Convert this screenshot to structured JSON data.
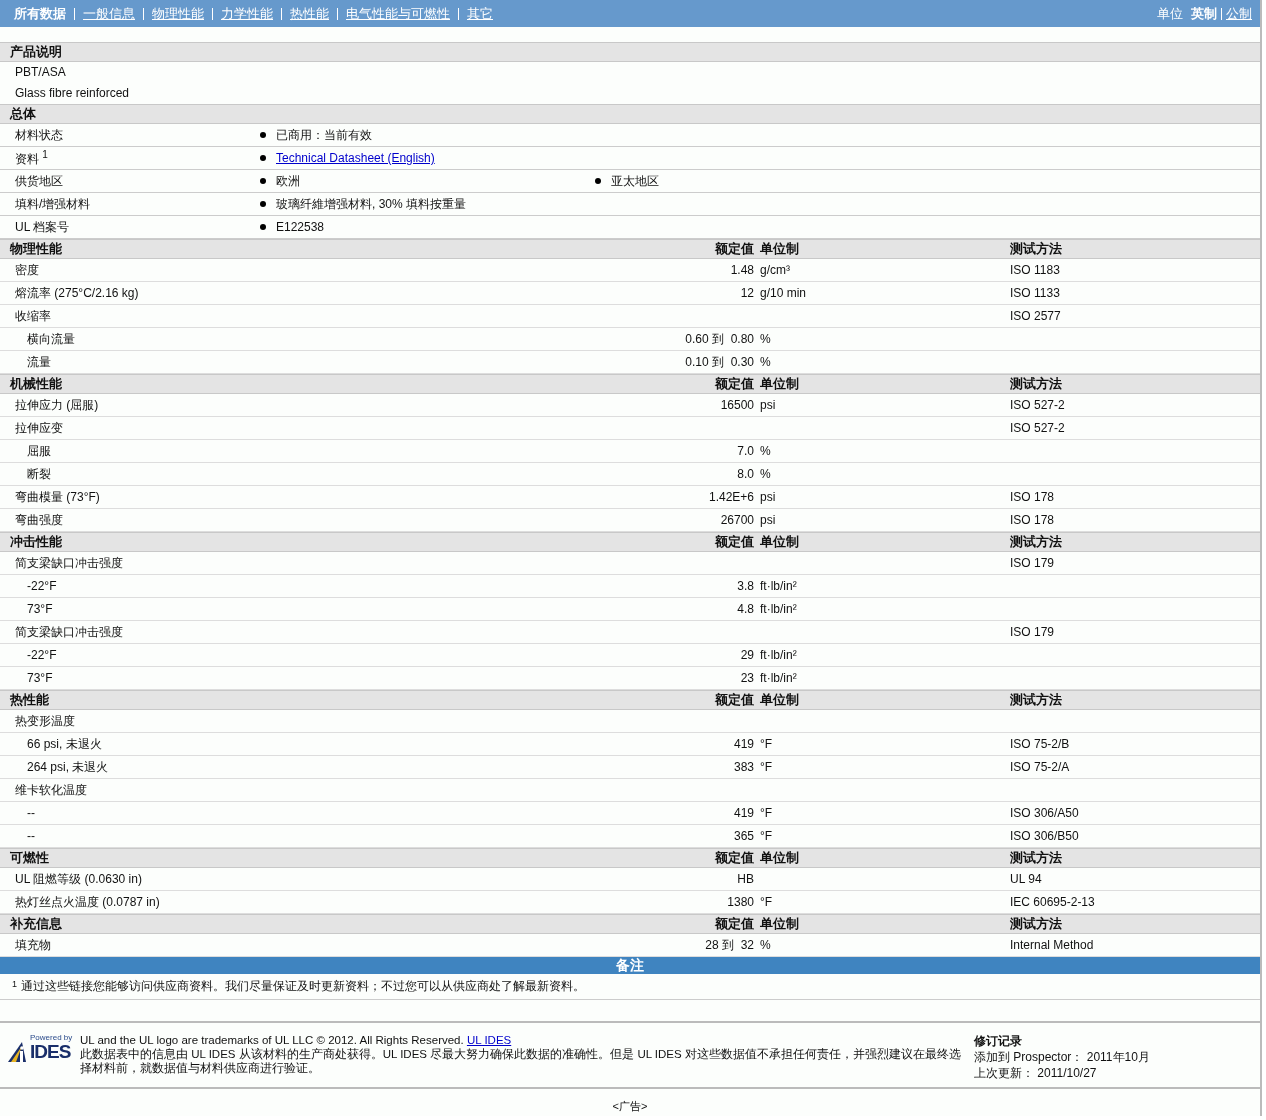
{
  "nav": {
    "tabs": [
      {
        "label": "所有数据",
        "selected": true
      },
      {
        "label": "一般信息",
        "selected": false
      },
      {
        "label": "物理性能",
        "selected": false
      },
      {
        "label": "力学性能",
        "selected": false
      },
      {
        "label": "热性能",
        "selected": false
      },
      {
        "label": "电气性能与可燃性",
        "selected": false
      },
      {
        "label": "其它",
        "selected": false
      }
    ],
    "units_label": "单位",
    "units": [
      {
        "label": "英制",
        "selected": true
      },
      {
        "label": "公制",
        "selected": false
      }
    ]
  },
  "description": {
    "title": "产品说明",
    "lines": [
      "PBT/ASA",
      "Glass fibre reinforced"
    ]
  },
  "general": {
    "title": "总体",
    "rows": [
      {
        "label": "材料状态",
        "values": [
          {
            "kind": "text",
            "text": "已商用：当前有效"
          }
        ]
      },
      {
        "label": "资料 $^{1}$",
        "values": [
          {
            "kind": "link",
            "text": "Technical Datasheet (English)"
          }
        ]
      },
      {
        "label": "供货地区",
        "values": [
          {
            "kind": "text",
            "text": "欧洲"
          },
          {
            "kind": "text",
            "text": "亚太地区"
          }
        ]
      },
      {
        "label": "填料/增强材料",
        "values": [
          {
            "kind": "text",
            "text": "玻璃纤維增强材料, 30% 填料按重量"
          }
        ]
      },
      {
        "label": "UL 档案号",
        "values": [
          {
            "kind": "text",
            "text": "E122538"
          }
        ]
      }
    ]
  },
  "sections": [
    {
      "title": "物理性能",
      "col_value": "额定值",
      "col_unit": "单位制",
      "col_method": "测试方法",
      "rows": [
        {
          "label": "密度",
          "value": "1.48",
          "unit": "g/cm³",
          "method": "ISO 1183"
        },
        {
          "label": "熔流率  (275°C/2.16 kg)",
          "value": "12",
          "unit": "g/10 min",
          "method": "ISO 1133"
        },
        {
          "label": "收缩率",
          "method": "ISO 2577",
          "children": [
            {
              "label": "横向流量",
              "value": "0.60 到  0.80",
              "unit": "%"
            },
            {
              "label": "流量",
              "value": "0.10 到  0.30",
              "unit": "%"
            }
          ]
        }
      ]
    },
    {
      "title": "机械性能",
      "col_value": "额定值",
      "col_unit": "单位制",
      "col_method": "测试方法",
      "rows": [
        {
          "label": "拉伸应力  (屈服)",
          "value": "16500",
          "unit": "psi",
          "method": "ISO 527-2"
        },
        {
          "label": "拉伸应变",
          "method": "ISO 527-2",
          "children": [
            {
              "label": "屈服",
              "value": "7.0",
              "unit": "%"
            },
            {
              "label": "断裂",
              "value": "8.0",
              "unit": "%"
            }
          ]
        },
        {
          "label": "弯曲模量  (73°F)",
          "value": "1.42E+6",
          "unit": "psi",
          "method": "ISO 178"
        },
        {
          "label": "弯曲强度",
          "value": "26700",
          "unit": "psi",
          "method": "ISO 178"
        }
      ]
    },
    {
      "title": "冲击性能",
      "col_value": "额定值",
      "col_unit": "单位制",
      "col_method": "测试方法",
      "rows": [
        {
          "label": "简支梁缺口冲击强度",
          "method": "ISO 179",
          "children": [
            {
              "label": "-22°F",
              "value": "3.8",
              "unit": "ft·lb/in²"
            },
            {
              "label": "73°F",
              "value": "4.8",
              "unit": "ft·lb/in²"
            }
          ]
        },
        {
          "label": "简支梁缺口冲击强度",
          "method": "ISO 179",
          "children": [
            {
              "label": "-22°F",
              "value": "29",
              "unit": "ft·lb/in²"
            },
            {
              "label": "73°F",
              "value": "23",
              "unit": "ft·lb/in²"
            }
          ]
        }
      ]
    },
    {
      "title": "热性能",
      "col_value": "额定值",
      "col_unit": "单位制",
      "col_method": "测试方法",
      "rows": [
        {
          "label": "热变形温度",
          "children": [
            {
              "label": "66 psi, 未退火",
              "value": "419",
              "unit": "°F",
              "method": "ISO 75-2/B"
            },
            {
              "label": "264 psi, 未退火",
              "value": "383",
              "unit": "°F",
              "method": "ISO 75-2/A"
            }
          ]
        },
        {
          "label": "维卡软化温度",
          "children": [
            {
              "label": "--",
              "value": "419",
              "unit": "°F",
              "method": "ISO 306/A50"
            },
            {
              "label": "--",
              "value": "365",
              "unit": "°F",
              "method": "ISO 306/B50"
            }
          ]
        }
      ]
    },
    {
      "title": "可燃性",
      "col_value": "额定值",
      "col_unit": "单位制",
      "col_method": "测试方法",
      "rows": [
        {
          "label": "UL 阻燃等级  (0.0630 in)",
          "value": "HB",
          "method": "UL 94"
        },
        {
          "label": "热灯丝点火温度  (0.0787 in)",
          "value": "1380",
          "unit": "°F",
          "method": "IEC 60695-2-13"
        }
      ]
    },
    {
      "title": "补充信息",
      "col_value": "额定值",
      "col_unit": "单位制",
      "col_method": "测试方法",
      "rows": [
        {
          "label": "填充物",
          "value": "28 到  32",
          "unit": "%",
          "method": "Internal Method"
        }
      ]
    }
  ],
  "notes": {
    "title": "备注",
    "items": [
      {
        "mark": "1",
        "text": "通过这些链接您能够访问供应商资料。我们尽量保证及时更新资料；不过您可以从供应商处了解最新资料。"
      }
    ]
  },
  "footer": {
    "logo_top": "Powered by",
    "logo_brand": "IDES",
    "trademark": "UL and the UL logo are trademarks of UL LLC © 2012. All Rights Reserved.",
    "trademark_link": "UL IDES",
    "disclaimer": "此数据表中的信息由  UL IDES 从该材料的生产商处获得。UL IDES 尽最大努力确保此数据的准确性。但是  UL IDES 对这些数据值不承担任何责任，并强烈建议在最终选择材料前，就数据值与材料供应商进行验证。",
    "revision": {
      "title": "修订记录",
      "rows": [
        {
          "label": "添加到  Prospector：",
          "value": "2011年10月"
        },
        {
          "label": "上次更新：",
          "value": "2011/10/27"
        }
      ]
    }
  },
  "ad": "<广告>"
}
